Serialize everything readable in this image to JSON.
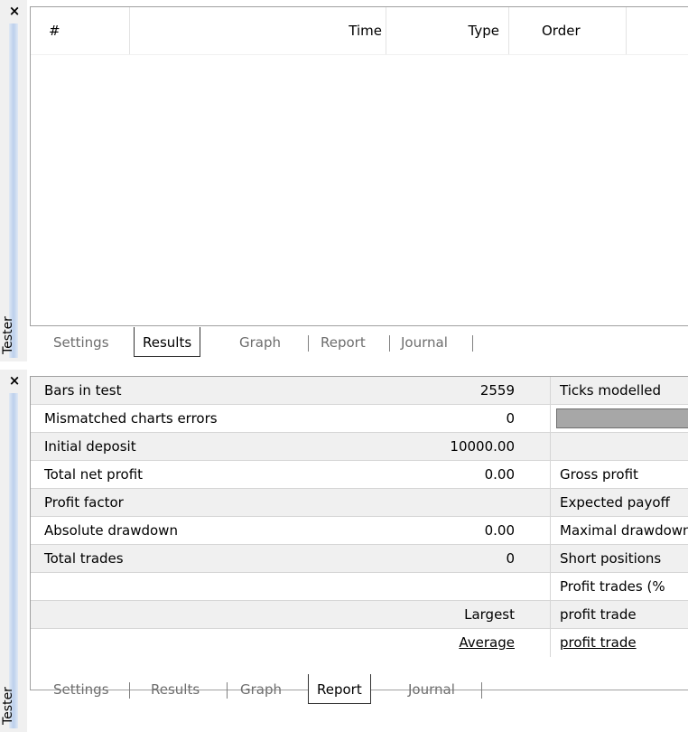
{
  "sidebar": {
    "label": "Tester",
    "close": "×"
  },
  "results": {
    "columns": [
      "#",
      "Time",
      "Type",
      "Order"
    ],
    "tabs": [
      "Settings",
      "Results",
      "Graph",
      "Report",
      "Journal"
    ],
    "active_tab": "Results"
  },
  "report": {
    "tabs": [
      "Settings",
      "Results",
      "Graph",
      "Report",
      "Journal"
    ],
    "active_tab": "Report",
    "rows": [
      {
        "label": "Bars in test",
        "value": "2559",
        "label2": "Ticks modelled"
      },
      {
        "label": "Mismatched charts errors",
        "value": "0",
        "label2": ""
      },
      {
        "label": "Initial deposit",
        "value": "10000.00",
        "label2": ""
      },
      {
        "label": "Total net profit",
        "value": "0.00",
        "label2": "Gross profit"
      },
      {
        "label": "Profit factor",
        "value": "",
        "label2": "Expected payoff"
      },
      {
        "label": "Absolute drawdown",
        "value": "0.00",
        "label2": "Maximal drawdown"
      },
      {
        "label": "Total trades",
        "value": "0",
        "label2": "Short positions"
      },
      {
        "label": "",
        "value": "",
        "label2": "Profit trades (%"
      },
      {
        "label": "",
        "value": "Largest",
        "label2": "profit trade"
      },
      {
        "label": "",
        "value": "Average",
        "label2": "profit trade"
      }
    ]
  }
}
